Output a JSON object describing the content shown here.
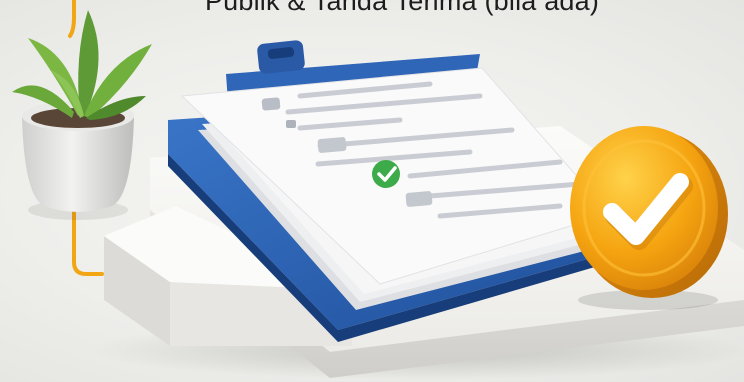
{
  "caption": {
    "text": "Publik & Tanda Terima (bila ada)"
  },
  "illustration": {
    "subject": "clipboard-with-documents-and-approval-badge",
    "icons": [
      "plant-pot-icon",
      "clipboard-icon",
      "document-stack-icon",
      "small-check-icon",
      "check-badge-icon",
      "orange-connector-line"
    ],
    "colors": {
      "background": "#eeeeec",
      "connector": "#f2a614",
      "clipboard_blue": "#2f66b8",
      "paper": "#fafafa",
      "paper_lines": "#c9cdd3",
      "small_check": "#3dab4a",
      "badge_orange": "#f5a410",
      "badge_check": "#ffffff",
      "plant_green": "#5e9a35",
      "pot": "#d9d9d7",
      "platform": "#f3f2ef"
    }
  }
}
